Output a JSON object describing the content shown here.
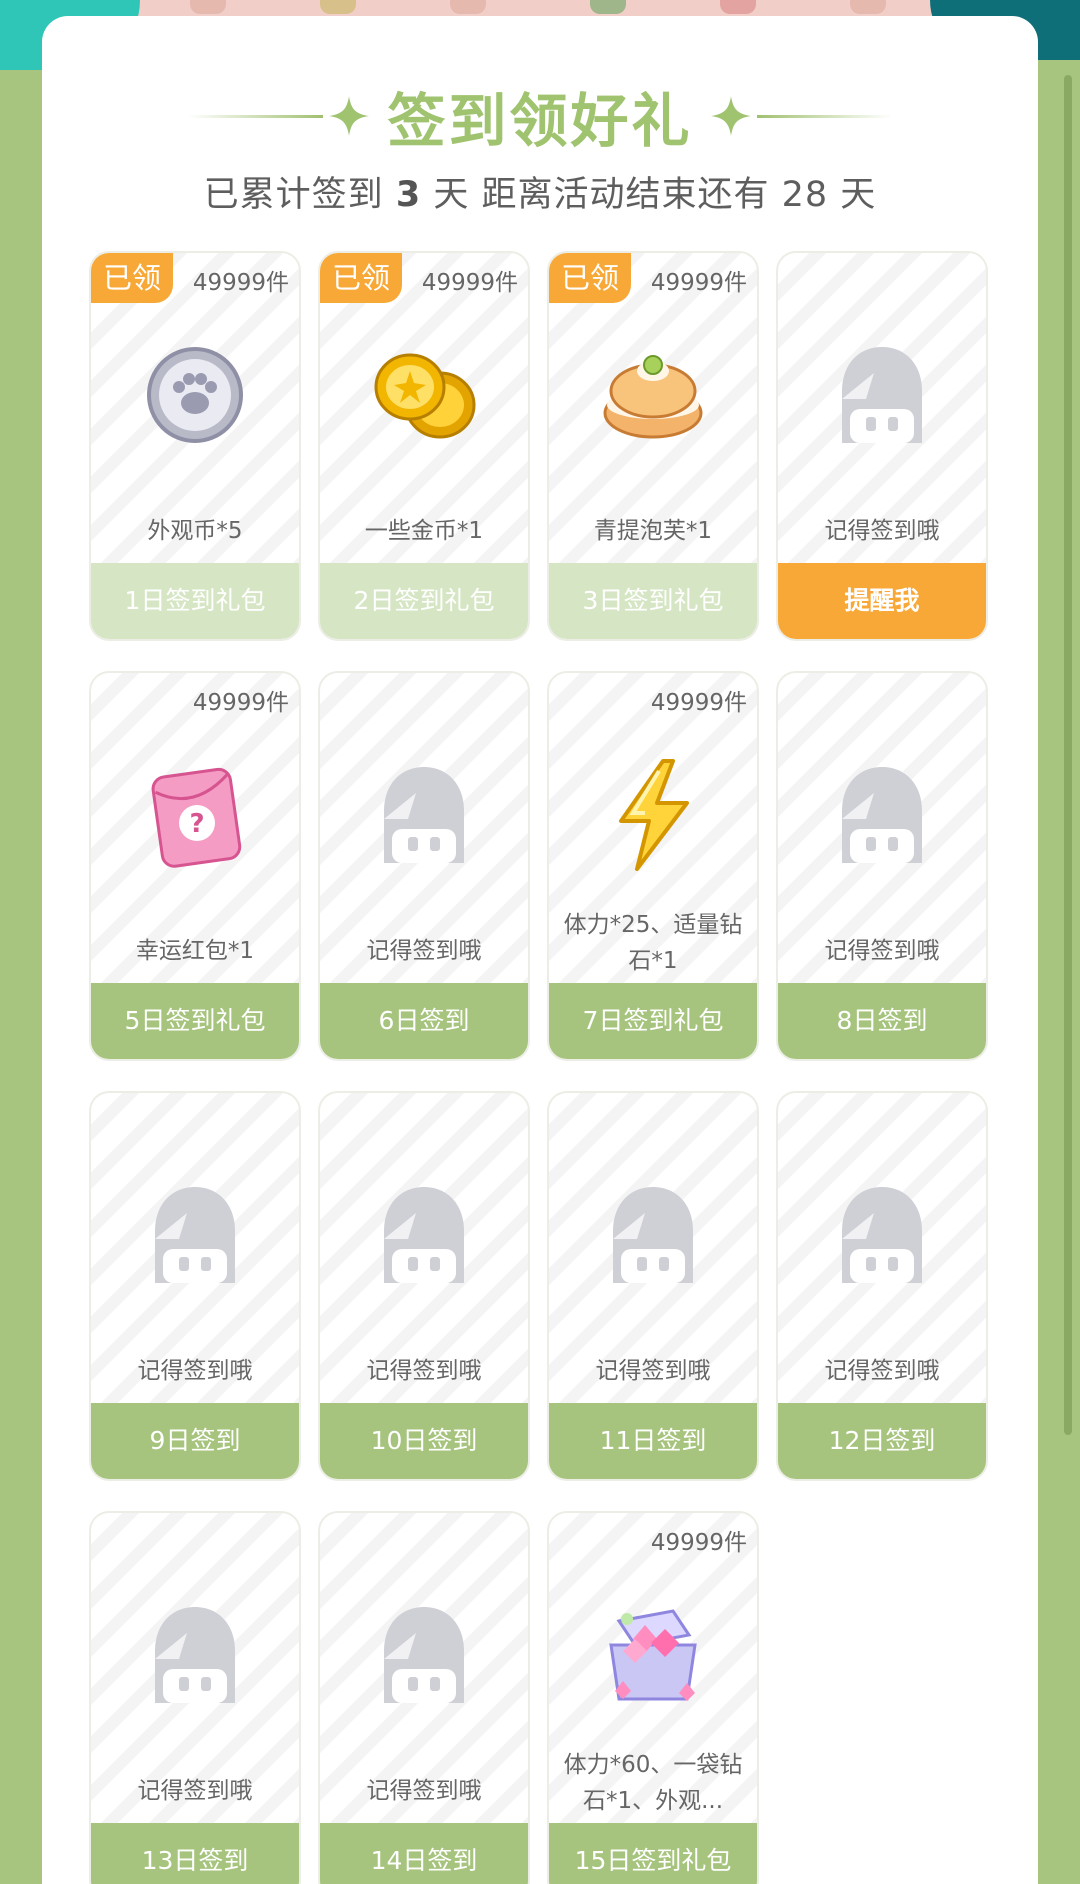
{
  "header": {
    "title": "签到领好礼",
    "subtitle_prefix": "已累计签到",
    "signed_days": "3",
    "subtitle_mid": "天  距离活动结束还有",
    "remaining_days": "28",
    "subtitle_suffix": "天"
  },
  "colors": {
    "background": "#a8c57f",
    "accent_green": "#9fc36f",
    "badge_orange": "#f8a836",
    "button_green": "#a6c47d",
    "button_claimed": "#d6e6c4"
  },
  "cards": [
    {
      "badge": "已领",
      "qty": "49999件",
      "name": "外观币*5",
      "button": "1日签到礼包",
      "state": "claimed",
      "icon": "paw-coin-icon"
    },
    {
      "badge": "已领",
      "qty": "49999件",
      "name": "一些金币*1",
      "button": "2日签到礼包",
      "state": "claimed",
      "icon": "gold-coins-icon"
    },
    {
      "badge": "已领",
      "qty": "49999件",
      "name": "青提泡芙*1",
      "button": "3日签到礼包",
      "state": "claimed",
      "icon": "cream-puff-icon"
    },
    {
      "badge": "",
      "qty": "",
      "name": "记得签到哦",
      "button": "提醒我",
      "state": "remind",
      "icon": "mystery-mascot-icon"
    },
    {
      "badge": "",
      "qty": "49999件",
      "name": "幸运红包*1",
      "button": "5日签到礼包",
      "state": "locked",
      "icon": "lucky-envelope-icon"
    },
    {
      "badge": "",
      "qty": "",
      "name": "记得签到哦",
      "button": "6日签到",
      "state": "locked",
      "icon": "mystery-mascot-icon"
    },
    {
      "badge": "",
      "qty": "49999件",
      "name": "体力*25、适量钻石*1",
      "button": "7日签到礼包",
      "state": "locked",
      "icon": "lightning-icon"
    },
    {
      "badge": "",
      "qty": "",
      "name": "记得签到哦",
      "button": "8日签到",
      "state": "locked",
      "icon": "mystery-mascot-icon"
    },
    {
      "badge": "",
      "qty": "",
      "name": "记得签到哦",
      "button": "9日签到",
      "state": "locked",
      "icon": "mystery-mascot-icon"
    },
    {
      "badge": "",
      "qty": "",
      "name": "记得签到哦",
      "button": "10日签到",
      "state": "locked",
      "icon": "mystery-mascot-icon"
    },
    {
      "badge": "",
      "qty": "",
      "name": "记得签到哦",
      "button": "11日签到",
      "state": "locked",
      "icon": "mystery-mascot-icon"
    },
    {
      "badge": "",
      "qty": "",
      "name": "记得签到哦",
      "button": "12日签到",
      "state": "locked",
      "icon": "mystery-mascot-icon"
    },
    {
      "badge": "",
      "qty": "",
      "name": "记得签到哦",
      "button": "13日签到",
      "state": "locked",
      "icon": "mystery-mascot-icon"
    },
    {
      "badge": "",
      "qty": "",
      "name": "记得签到哦",
      "button": "14日签到",
      "state": "locked",
      "icon": "mystery-mascot-icon"
    },
    {
      "badge": "",
      "qty": "49999件",
      "name": "体力*60、一袋钻石*1、外观...",
      "button": "15日签到礼包",
      "state": "locked",
      "icon": "diamond-chest-icon"
    }
  ]
}
